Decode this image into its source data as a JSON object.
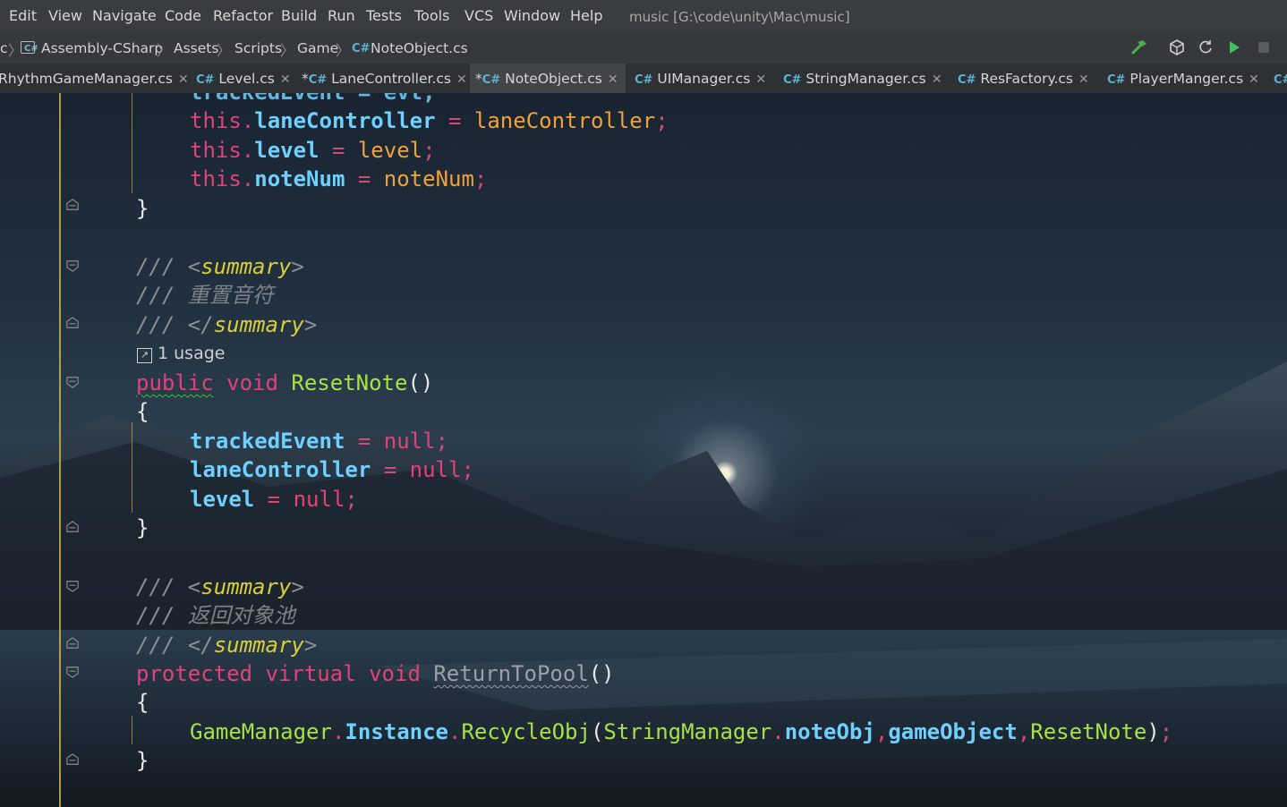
{
  "menu": {
    "items": [
      "Edit",
      "View",
      "Navigate",
      "Code",
      "Refactor",
      "Build",
      "Run",
      "Tests",
      "Tools",
      "VCS",
      "Window",
      "Help"
    ],
    "project": "music [G:\\code\\unity\\Mac\\music]"
  },
  "breadcrumb": {
    "lead": "c",
    "items": [
      "Assembly-CSharp",
      "Assets",
      "Scripts",
      "Game",
      "NoteObject.cs"
    ],
    "cs_badge": "C#"
  },
  "tabs": [
    {
      "label": "RhythmGameManager.cs",
      "badge": "",
      "modified": false,
      "active": false
    },
    {
      "label": "Level.cs",
      "badge": "C#",
      "modified": false,
      "active": false
    },
    {
      "label": "LaneController.cs",
      "badge": "C#",
      "modified": true,
      "active": false
    },
    {
      "label": "NoteObject.cs",
      "badge": "C#",
      "modified": true,
      "active": true
    },
    {
      "label": "UIManager.cs",
      "badge": "C#",
      "modified": false,
      "active": false
    },
    {
      "label": "StringManager.cs",
      "badge": "C#",
      "modified": false,
      "active": false
    },
    {
      "label": "ResFactory.cs",
      "badge": "C#",
      "modified": false,
      "active": false
    },
    {
      "label": "PlayerManger.cs",
      "badge": "C#",
      "modified": false,
      "active": false
    },
    {
      "label": "",
      "badge": "C#",
      "modified": false,
      "active": false
    }
  ],
  "toolbar": {
    "icons": [
      "build-hammer-icon",
      "unity-icon",
      "refresh-icon",
      "run-icon",
      "stop-icon"
    ],
    "colors": {
      "hammer": "#4caf50",
      "run": "#3fbf5f"
    }
  },
  "editor": {
    "partial_line": "trackedEvent = evt;",
    "lines": {
      "l1_this": "this.",
      "l1_field": "laneController",
      "l1_eq": " = ",
      "l1_val": "laneController",
      "l1_end": ";",
      "l2_this": "this.",
      "l2_field": "level",
      "l2_eq": " = ",
      "l2_val": "level",
      "l2_end": ";",
      "l3_this": "this.",
      "l3_field": "noteNum",
      "l3_eq": " = ",
      "l3_val": "noteNum",
      "l3_end": ";",
      "close1": "}",
      "c1_slash": "/// ",
      "c1_open": "<",
      "c1_tag": "summary",
      "c1_close": ">",
      "c2_slash": "/// ",
      "c2_text": "重置音符",
      "c3_slash": "/// ",
      "c3_open": "</",
      "c3_tag": "summary",
      "c3_close": ">",
      "usage": "1 usage",
      "m1_public": "public",
      "m1_void": " void ",
      "m1_name": "ResetNote",
      "m1_paren": "()",
      "open2": "{",
      "r1_field": "trackedEvent",
      "r1_eq": " = ",
      "r1_val": "null",
      "r1_end": ";",
      "r2_field": "laneController",
      "r2_eq": " = ",
      "r2_val": "null",
      "r2_end": ";",
      "r3_field": "level",
      "r3_eq": " = ",
      "r3_val": "null",
      "r3_end": ";",
      "close2": "}",
      "d1_slash": "/// ",
      "d1_open": "<",
      "d1_tag": "summary",
      "d1_close": ">",
      "d2_slash": "/// ",
      "d2_text": "返回对象池",
      "d3_slash": "/// ",
      "d3_open": "</",
      "d3_tag": "summary",
      "d3_close": ">",
      "m2_protected": "protected",
      "m2_virtual": " virtual",
      "m2_void": " void ",
      "m2_name": "ReturnToPool",
      "m2_paren": "()",
      "open3": "{",
      "g_cls": "GameManager",
      "g_dot1": ".",
      "g_inst": "Instance",
      "g_dot2": ".",
      "g_mth": "RecycleObj",
      "g_p1": "(",
      "g_cls2": "StringManager",
      "g_dot3": ".",
      "g_fld": "noteObj",
      "g_comma1": ",",
      "g_go": "gameObject",
      "g_comma2": ",",
      "g_reset": "ResetNote",
      "g_p2": ")",
      "g_end": ";",
      "close3": "}"
    }
  }
}
